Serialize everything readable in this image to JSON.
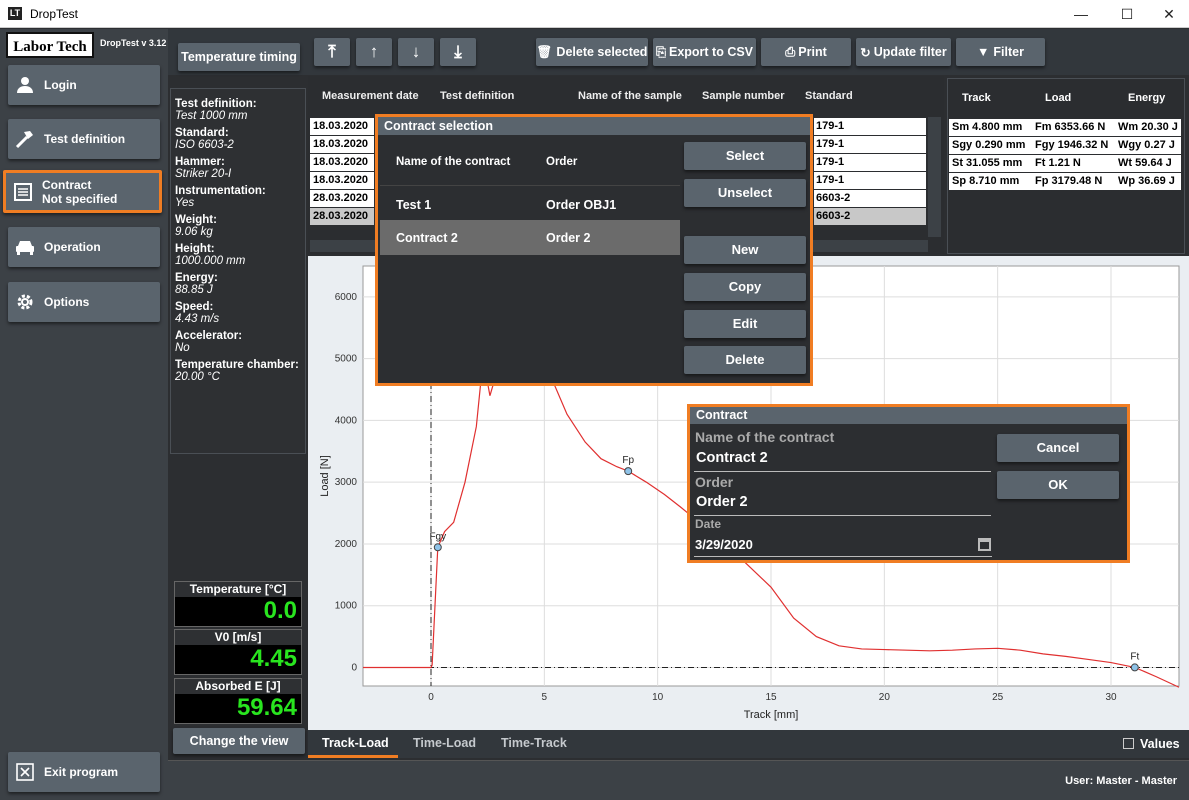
{
  "window": {
    "title": "DropTest",
    "minimize": "—",
    "maximize": "☐",
    "close": "✕",
    "icon_text": "LT"
  },
  "brand": {
    "logo": "Labor Tech",
    "version": "DropTest v 3.12"
  },
  "nav": [
    {
      "label": "Login",
      "icon": "user-icon"
    },
    {
      "label": "Test definition",
      "icon": "hammer-icon"
    },
    {
      "label": "Contract",
      "sub": "Not specified",
      "icon": "document-icon"
    },
    {
      "label": "Operation",
      "icon": "car-icon"
    },
    {
      "label": "Options",
      "icon": "gear-icon"
    }
  ],
  "exit": {
    "label": "Exit program"
  },
  "temp_timing": "Temperature timing",
  "info": {
    "test_definition_label": "Test definition:",
    "test_definition": "Test 1000 mm",
    "standard_label": "Standard:",
    "standard": "ISO 6603-2",
    "hammer_label": "Hammer:",
    "hammer": "Striker 20-I",
    "instrumentation_label": "Instrumentation:",
    "instrumentation": "Yes",
    "weight_label": "Weight:",
    "weight": "9.06   kg",
    "height_label": "Height:",
    "height": "1000.000   mm",
    "energy_label": "Energy:",
    "energy": "88.85   J",
    "speed_label": "Speed:",
    "speed": "4.43   m/s",
    "accelerator_label": "Accelerator:",
    "accelerator": "No",
    "temp_chamber_label": "Temperature chamber:",
    "temp_chamber": "20.00 °C"
  },
  "meters": [
    {
      "label": "Temperature [°C]",
      "value": "0.0"
    },
    {
      "label": "V0 [m/s]",
      "value": "4.45"
    },
    {
      "label": "Absorbed E [J]",
      "value": "59.64"
    }
  ],
  "change_view": "Change the view",
  "toolbar": {
    "top": "⤒",
    "up": "↑",
    "down": "↓",
    "bottom": "⤓",
    "delete": "Delete selected",
    "export": "Export to CSV",
    "print": "Print",
    "update": "Update filter",
    "filter": "Filter"
  },
  "table": {
    "headers": [
      "Measurement date",
      "Test definition",
      "Name of the sample",
      "Sample number",
      "Standard"
    ],
    "dates": [
      "18.03.2020",
      "18.03.2020",
      "18.03.2020",
      "18.03.2020",
      "28.03.2020",
      "28.03.2020"
    ],
    "standards": [
      "179-1",
      "179-1",
      "179-1",
      "179-1",
      "6603-2",
      "6603-2"
    ]
  },
  "results": {
    "headers": [
      "Track",
      "Load",
      "Energy"
    ],
    "rows": [
      [
        "Sm 4.800 mm",
        "Fm 6353.66 N",
        "Wm 20.30 J"
      ],
      [
        "Sgy 0.290 mm",
        "Fgy 1946.32 N",
        "Wgy 0.27 J"
      ],
      [
        "St 31.055 mm",
        "Ft 1.21 N",
        "Wt 59.64 J"
      ],
      [
        "Sp 8.710 mm",
        "Fp 3179.48 N",
        "Wp 36.69 J"
      ]
    ]
  },
  "chart_data": {
    "type": "line",
    "xlabel": "Track [mm]",
    "ylabel": "Load [N]",
    "xlim": [
      -3,
      33
    ],
    "ylim": [
      -300,
      6500
    ],
    "xticks": [
      0,
      5,
      10,
      15,
      20,
      25,
      30
    ],
    "yticks": [
      0,
      1000,
      2000,
      3000,
      4000,
      5000,
      6000
    ],
    "grid": true,
    "series": [
      {
        "color": "#e03030",
        "x": [
          -3,
          -1,
          0,
          0.05,
          0.3,
          0.6,
          1,
          1.5,
          2,
          2.3,
          2.6,
          3,
          3.3,
          3.6,
          3.9,
          4.3,
          4.8,
          5.3,
          6,
          6.8,
          7.5,
          8.2,
          8.7,
          9.5,
          10.3,
          11,
          12,
          13,
          14,
          15,
          16,
          17,
          18,
          19,
          20,
          21,
          22,
          23,
          24,
          25,
          26,
          27,
          28,
          29,
          30,
          31.05,
          32,
          33
        ],
        "y": [
          0,
          0,
          0,
          40,
          1946,
          2200,
          2350,
          3000,
          3900,
          5000,
          4400,
          4900,
          5600,
          6300,
          6350,
          6000,
          5400,
          4700,
          4100,
          3650,
          3380,
          3250,
          3179,
          3000,
          2800,
          2600,
          2300,
          2000,
          1650,
          1300,
          800,
          500,
          350,
          300,
          290,
          280,
          270,
          280,
          300,
          310,
          280,
          220,
          180,
          130,
          80,
          1,
          -150,
          -320
        ]
      }
    ],
    "markers": [
      {
        "label": "Fgy",
        "x": 0.3,
        "y": 1946
      },
      {
        "label": "Fp",
        "x": 8.7,
        "y": 3179
      },
      {
        "label": "Ft",
        "x": 31.05,
        "y": 1
      }
    ]
  },
  "tabs": [
    "Track-Load",
    "Time-Load",
    "Time-Track"
  ],
  "values_label": "Values",
  "status": {
    "user": "User:  Master  -  Master"
  },
  "contract_dialog": {
    "title": "Contract selection",
    "col_name": "Name of the contract",
    "col_order": "Order",
    "rows": [
      {
        "name": "Test 1",
        "order": "Order OBJ1"
      },
      {
        "name": "Contract 2",
        "order": "Order 2"
      }
    ],
    "buttons": {
      "select": "Select",
      "unselect": "Unselect",
      "new": "New",
      "copy": "Copy",
      "edit": "Edit",
      "delete": "Delete"
    }
  },
  "contract_edit": {
    "title": "Contract",
    "name_label": "Name of the contract",
    "name": "Contract 2",
    "order_label": "Order",
    "order": "Order 2",
    "date_label": "Date",
    "date": "3/29/2020",
    "cancel": "Cancel",
    "ok": "OK"
  }
}
